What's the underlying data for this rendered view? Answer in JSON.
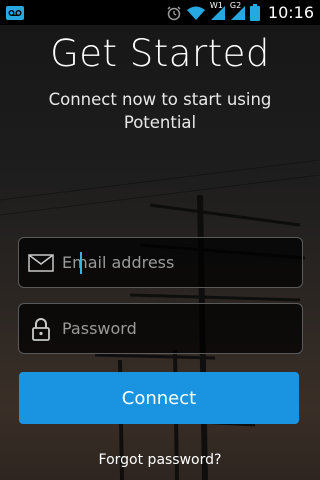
{
  "status_bar": {
    "time": "10:16",
    "network_labels": [
      "W1",
      "G2"
    ],
    "icons": [
      "voicemail-icon",
      "alarm-icon",
      "wifi-icon",
      "signal-icon",
      "signal-icon",
      "battery-icon"
    ]
  },
  "header": {
    "title": "Get Started",
    "subtitle": "Connect now to start using Potential"
  },
  "form": {
    "email_placeholder": "Email address",
    "email_value": "",
    "password_placeholder": "Password",
    "password_value": "",
    "connect_label": "Connect",
    "forgot_label": "Forgot password?"
  },
  "colors": {
    "accent": "#1a94e0",
    "status_icon": "#26a9e0"
  }
}
